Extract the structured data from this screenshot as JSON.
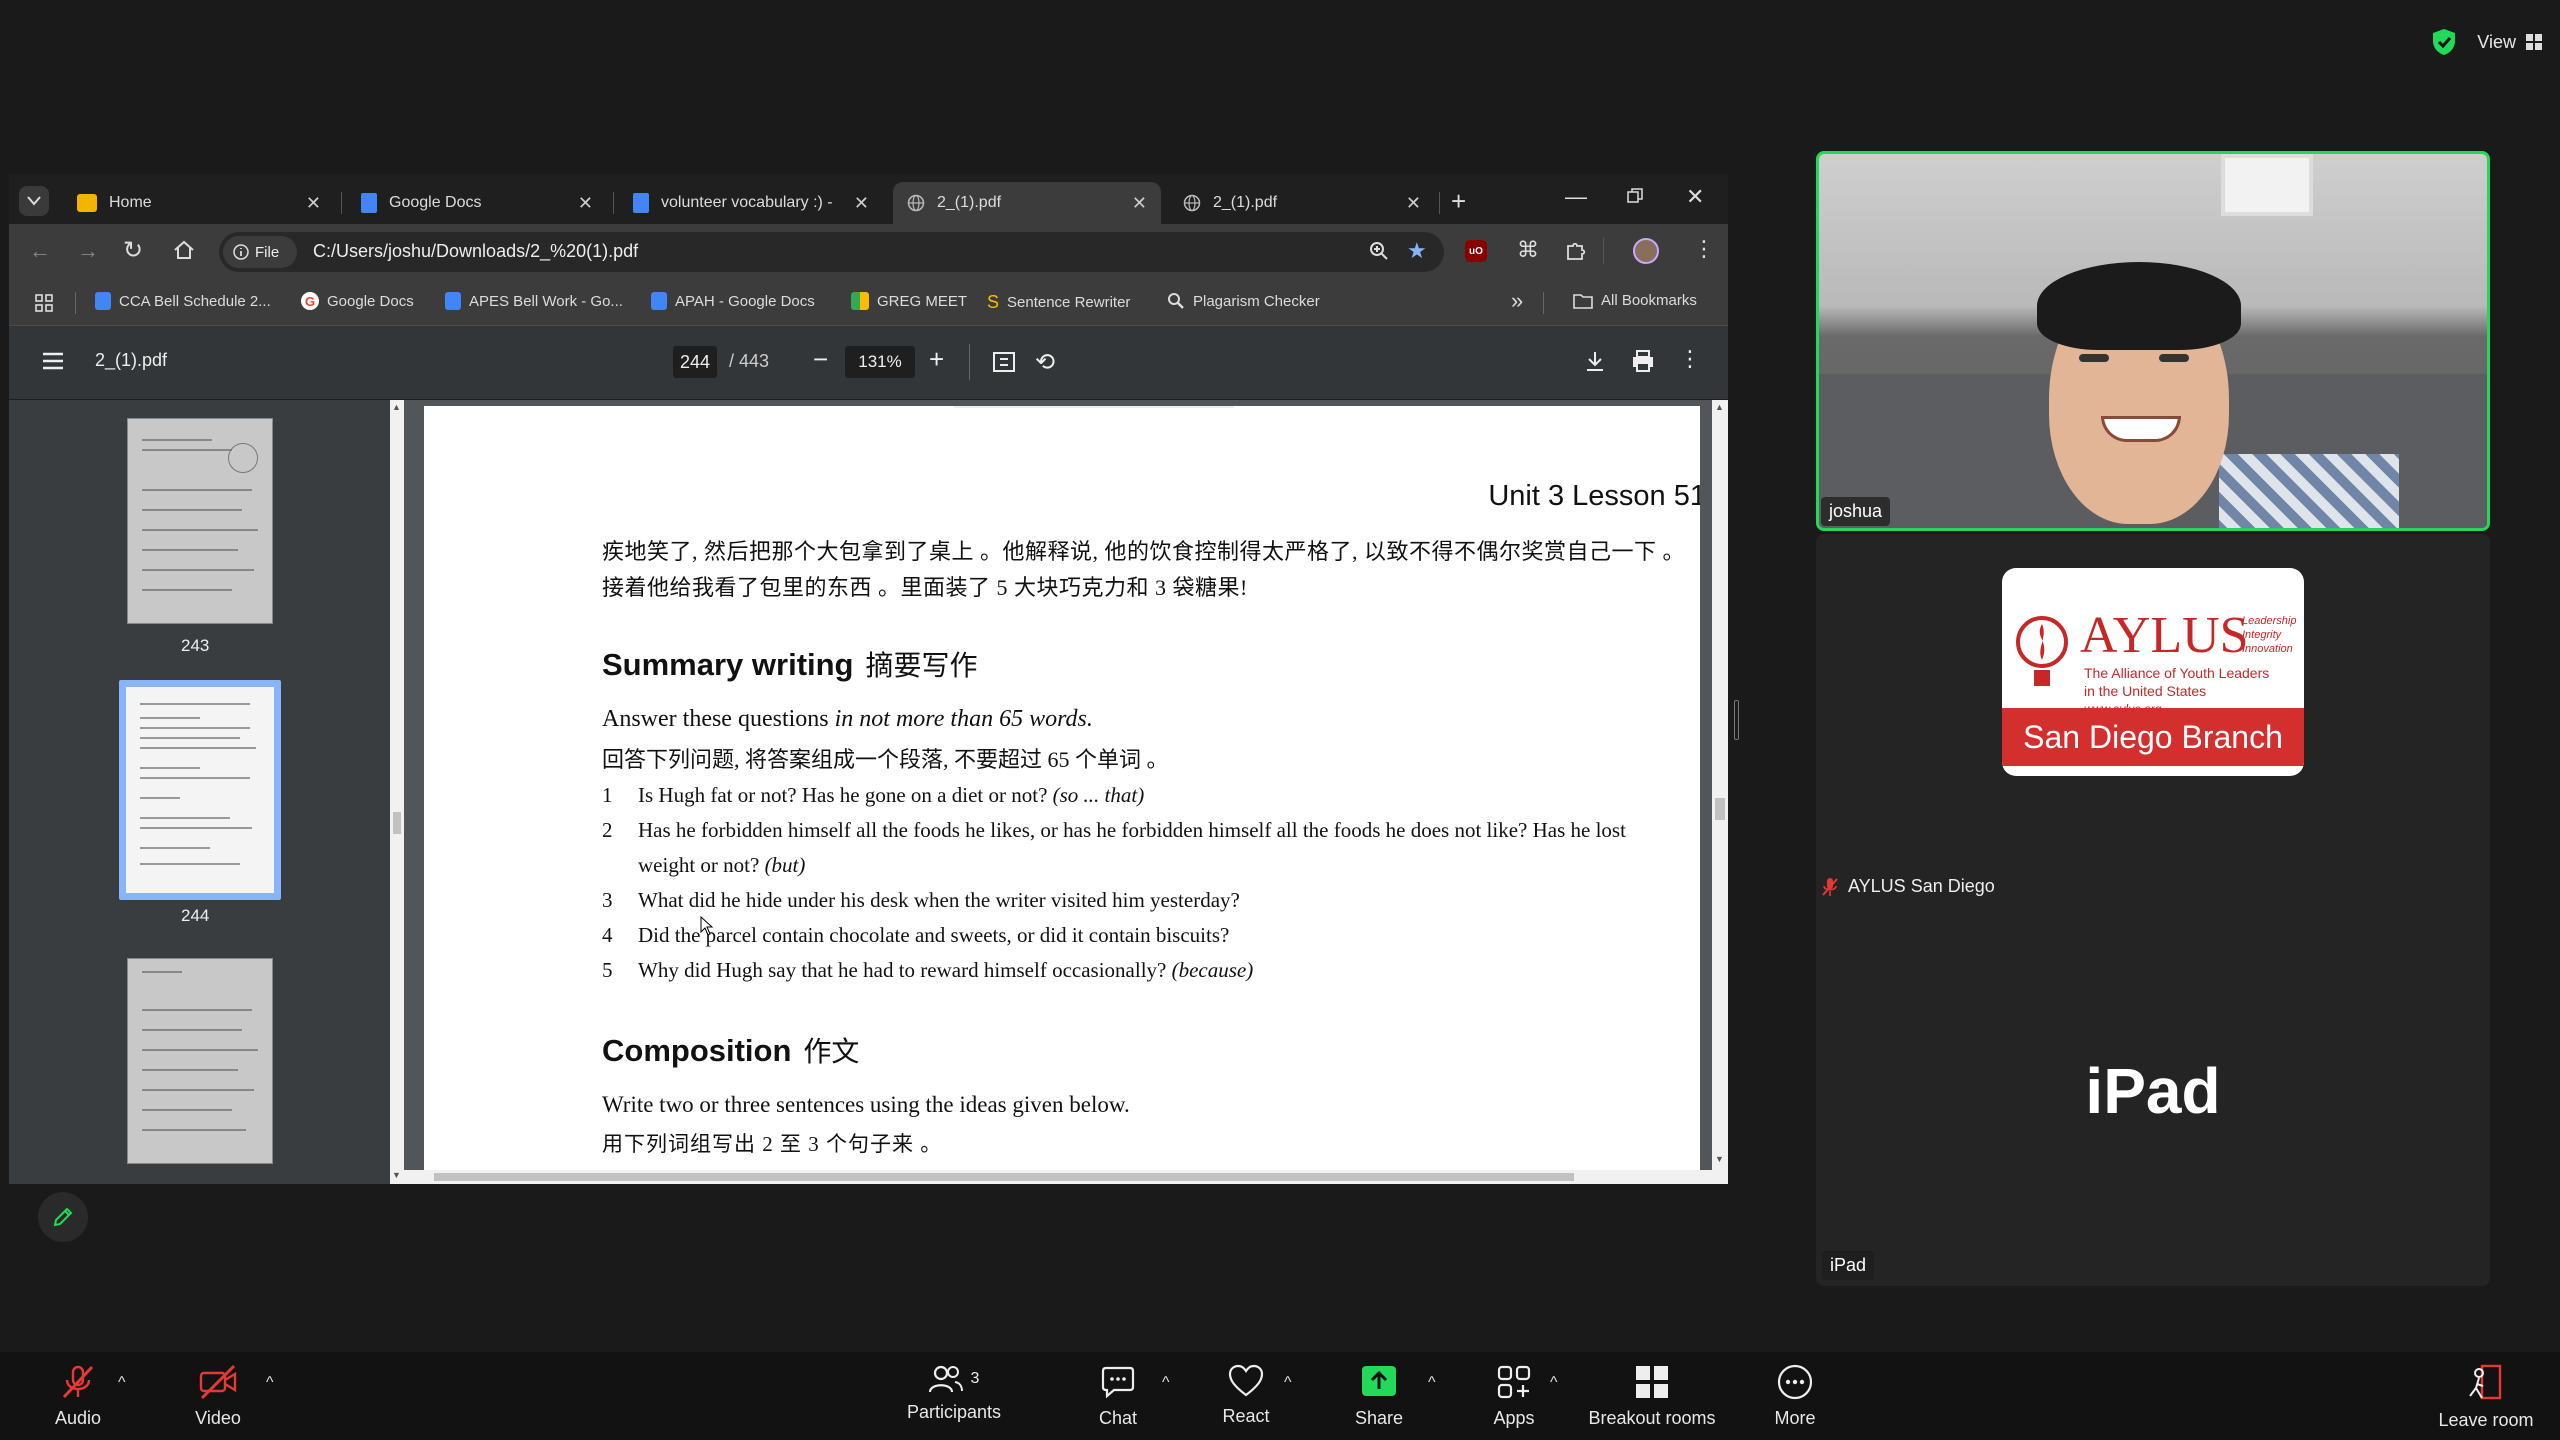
{
  "zoom_top": {
    "view_label": "View"
  },
  "browser": {
    "tabs": [
      {
        "title": "Home",
        "favicon_color": "#f4b400",
        "active": false
      },
      {
        "title": "Google Docs",
        "favicon_color": "#4285f4",
        "active": false
      },
      {
        "title": "volunteer vocabulary :) -",
        "favicon_color": "#4285f4",
        "active": false
      },
      {
        "title": "2_(1).pdf",
        "favicon_color": "#9aa0a6",
        "active": true
      },
      {
        "title": "2_(1).pdf",
        "favicon_color": "#9aa0a6",
        "active": false
      }
    ],
    "new_tab": "+",
    "scheme_label": "File",
    "url": "C:/Users/joshu/Downloads/2_%20(1).pdf",
    "bookmarks": [
      {
        "label": "CCA Bell Schedule 2...",
        "color": "#4285f4"
      },
      {
        "label": "Google Docs",
        "color": "#ea4335"
      },
      {
        "label": "APES Bell Work - Go...",
        "color": "#4285f4"
      },
      {
        "label": "APAH - Google Docs",
        "color": "#4285f4"
      },
      {
        "label": "GREG MEET",
        "color": "#34a853"
      },
      {
        "label": "Sentence Rewriter",
        "color": "#fbbc05"
      },
      {
        "label": "Plagarism Checker",
        "color": "#bbbbbb"
      }
    ],
    "all_bookmarks": "All Bookmarks",
    "overflow": "»"
  },
  "pdf": {
    "filename": "2_(1).pdf",
    "page_current": "244",
    "page_total": "/ 443",
    "zoom": "131%",
    "thumbs": [
      {
        "num": "243"
      },
      {
        "num": "244"
      }
    ],
    "header": "Unit 3   Lesson 51",
    "cn_para1": "疾地笑了, 然后把那个大包拿到了桌上 。他解释说, 他的饮食控制得太严格了, 以致不得不偶尔奖赏自己一下 。",
    "cn_para2": "接着他给我看了包里的东西 。里面装了 5 大块巧克力和 3 袋糖果!",
    "summary_title": "Summary writing",
    "summary_cn": "摘要写作",
    "instr_pre": "Answer these questions ",
    "instr_em": "in not more than 65 words.",
    "instr_cn": "回答下列问题, 将答案组成一个段落, 不要超过 65 个单词 。",
    "questions": [
      {
        "n": "1",
        "text": "Is Hugh fat or not? Has he gone on a diet or not?",
        "hint": "(so ... that)"
      },
      {
        "n": "2",
        "text": "Has he forbidden himself all the foods he likes, or has he forbidden himself all the foods he does not like? Has he lost",
        "hint": ""
      },
      {
        "n": "",
        "text": "weight or not?",
        "hint": "(but)"
      },
      {
        "n": "3",
        "text": "What did he hide under his desk when the writer visited him yesterday?",
        "hint": ""
      },
      {
        "n": "4",
        "text": "Did the parcel contain chocolate and sweets, or did it contain biscuits?",
        "hint": ""
      },
      {
        "n": "5",
        "text": "Why did Hugh say that he had to reward himself occasionally?",
        "hint": "(because)"
      }
    ],
    "composition_title": "Composition",
    "composition_cn": "作文",
    "comp_instr": "Write two or three sentences using the ideas given below.",
    "comp_cn": "用下列词组写出 2 至 3 个句子来 。"
  },
  "participants": {
    "joshua": {
      "name": "joshua"
    },
    "aylus": {
      "name": "AYLUS San Diego",
      "logo_title": "AYLUS",
      "logo_tag1": "Leadership",
      "logo_tag2": "Integrity",
      "logo_tag3": "Innovation",
      "logo_sub1": "The Alliance of Youth Leaders",
      "logo_sub2": "in the United States",
      "logo_url": "www.aylus.org",
      "branch": "San Diego Branch"
    },
    "ipad": {
      "name": "iPad",
      "big_label": "iPad"
    }
  },
  "controls": {
    "audio": "Audio",
    "video": "Video",
    "participants": "Participants",
    "participants_count": "3",
    "chat": "Chat",
    "react": "React",
    "share": "Share",
    "apps": "Apps",
    "breakout": "Breakout rooms",
    "more": "More",
    "leave": "Leave room"
  },
  "colors": {
    "accent": "#8ab4f8",
    "share_green": "#23d959",
    "active_speaker": "#23d959",
    "mute_red": "#e53935",
    "aylus_red": "#d32f2f"
  }
}
